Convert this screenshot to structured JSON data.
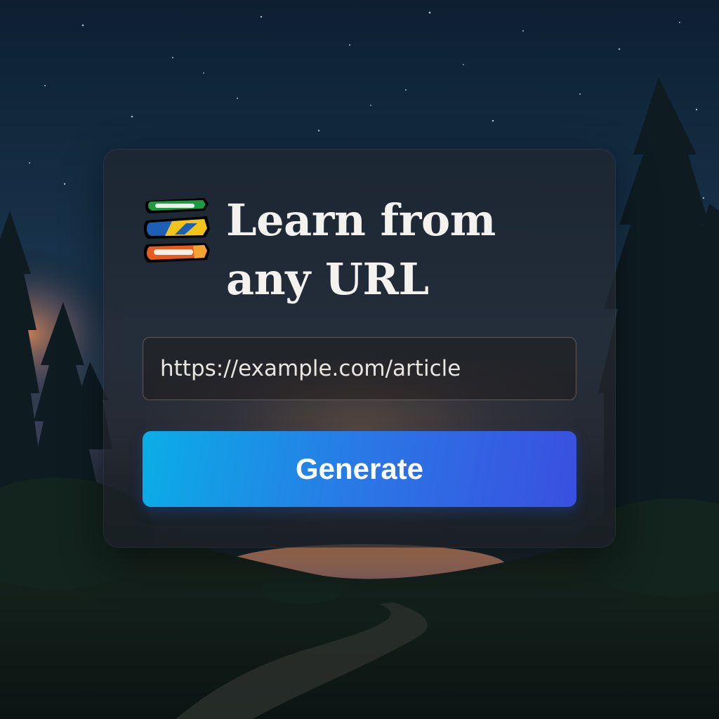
{
  "header": {
    "title_line1": "Learn from",
    "title_line2": "any URL",
    "logo_icon": "stacked-books-icon"
  },
  "form": {
    "url_placeholder": "https://example.com/article",
    "generate_label": "Generate"
  },
  "colors": {
    "button_gradient_start": "#0aaee6",
    "button_gradient_end": "#3a4fe0",
    "title_text": "#f4f2ee"
  }
}
